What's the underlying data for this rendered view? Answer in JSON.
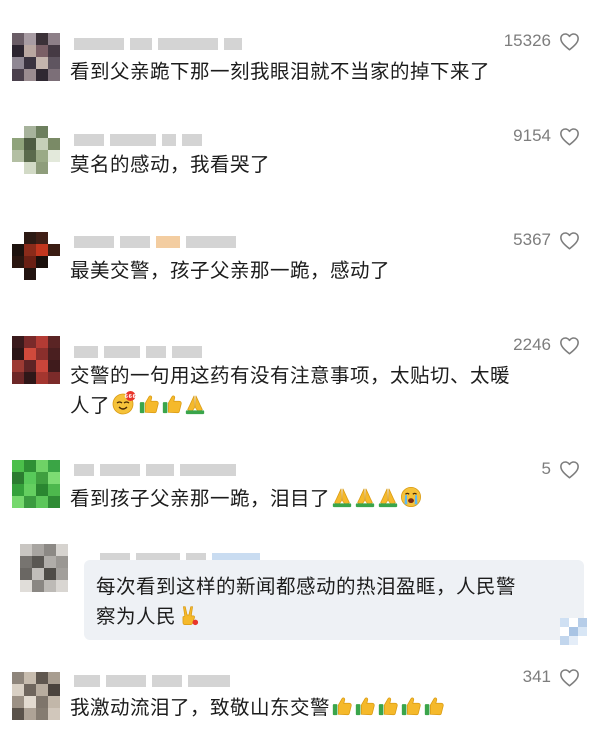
{
  "comments": [
    {
      "text": "看到父亲跪下那一刻我眼泪就不当家的掉下来了",
      "likes": "15326",
      "emoji": []
    },
    {
      "text": "莫名的感动，我看哭了",
      "likes": "9154",
      "emoji": []
    },
    {
      "text": "最美交警，孩子父亲那一跪，感动了",
      "likes": "5367",
      "emoji": []
    },
    {
      "text_line1": "交警的一句用这药有没有注意事项，太贴切、太暖",
      "text_line2": "人了",
      "likes": "2246",
      "emoji": [
        "emoji-666-face",
        "thumbs-up",
        "thumbs-up",
        "folded-hands"
      ]
    },
    {
      "text": "看到孩子父亲那一跪，泪目了",
      "likes": "5",
      "emoji": [
        "folded-hands",
        "folded-hands",
        "folded-hands",
        "crying-face"
      ]
    },
    {
      "text_line1": "每次看到这样的新闻都感动的热泪盈眶，人民警",
      "text_line2": "察为人民",
      "likes": "",
      "emoji": [
        "victory-hand"
      ]
    },
    {
      "text": "我激动流泪了，致敬山东交警",
      "likes": "341",
      "emoji": [
        "thumbs-up",
        "thumbs-up",
        "thumbs-up",
        "thumbs-up",
        "thumbs-up"
      ]
    }
  ],
  "colors": {
    "text": "#1c1c1c",
    "count": "#7d7d7d",
    "reply_bg": "#eef1f5",
    "emoji_yellow": "#f5b92b",
    "emoji_green": "#3aa54b"
  },
  "icons": {
    "like": "heart-outline-icon"
  }
}
